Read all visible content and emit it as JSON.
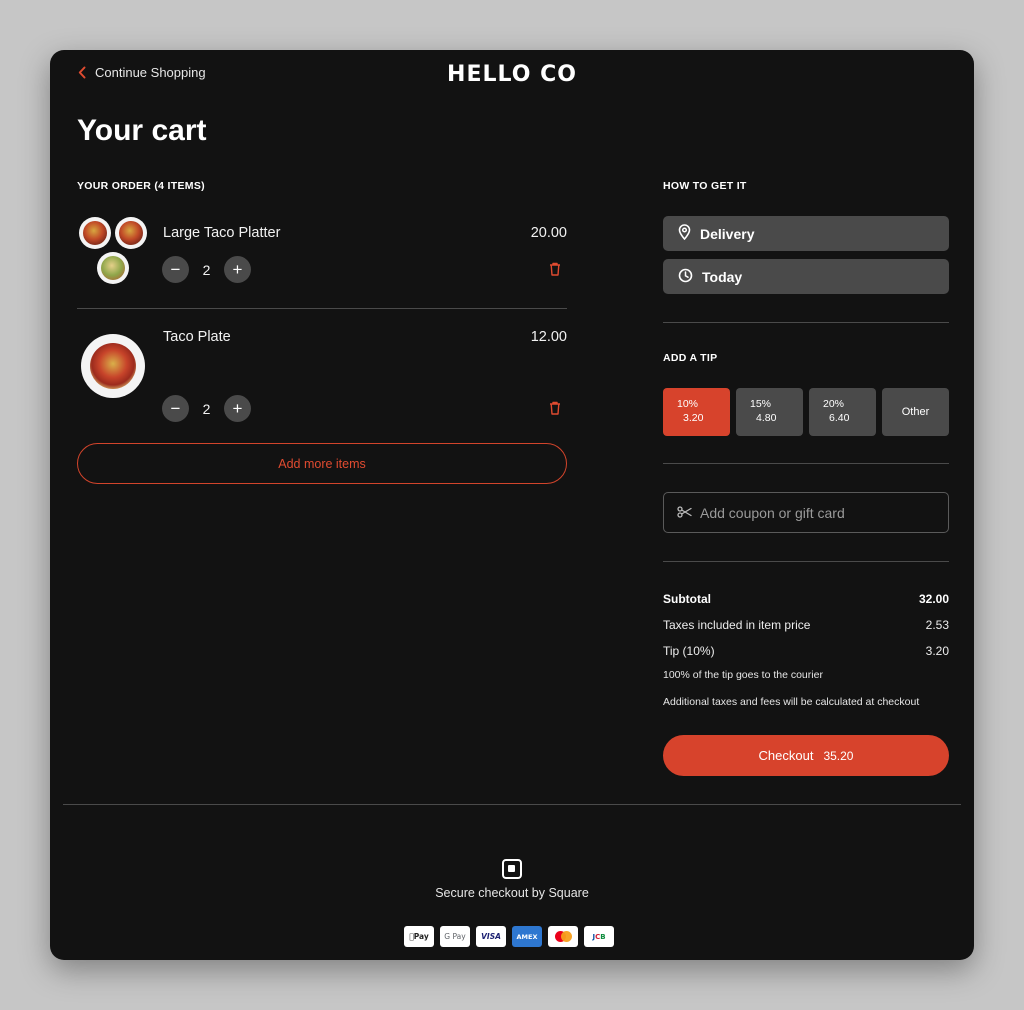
{
  "header": {
    "back_label": "Continue Shopping",
    "logo": "HELLO CO",
    "title": "Your cart"
  },
  "order": {
    "heading": "YOUR ORDER (4 ITEMS)",
    "items": [
      {
        "name": "Large Taco Platter",
        "price": "20.00",
        "qty": "2"
      },
      {
        "name": "Taco Plate",
        "price": "12.00",
        "qty": "2"
      }
    ],
    "add_more_label": "Add more items"
  },
  "fulfillment": {
    "heading": "HOW TO GET IT",
    "method": "Delivery",
    "time": "Today"
  },
  "tip": {
    "heading": "ADD A TIP",
    "options": [
      {
        "pct": "10%",
        "amount": "3.20",
        "selected": true
      },
      {
        "pct": "15%",
        "amount": "4.80",
        "selected": false
      },
      {
        "pct": "20%",
        "amount": "6.40",
        "selected": false
      }
    ],
    "other_label": "Other"
  },
  "coupon": {
    "placeholder": "Add coupon or gift card"
  },
  "summary": {
    "subtotal_label": "Subtotal",
    "subtotal": "32.00",
    "taxes_label": "Taxes included in item price",
    "taxes": "2.53",
    "tip_label": "Tip (10%)",
    "tip": "3.20",
    "tip_note": "100% of the tip goes to the courier",
    "fees_note": "Additional taxes and fees will be calculated at checkout"
  },
  "checkout": {
    "label": "Checkout",
    "total": "35.20"
  },
  "footer": {
    "secure_text": "Secure checkout by Square",
    "payment_methods": [
      "Apple Pay",
      "Google Pay",
      "VISA",
      "AMEX",
      "Mastercard",
      "JCB"
    ]
  },
  "colors": {
    "accent": "#d7432c",
    "background": "#121212",
    "surface": "#4a4a4a",
    "page_bg": "#c6c6c6"
  },
  "icons": {
    "back": "chevron-left-icon",
    "delivery": "location-pin-icon",
    "time": "clock-icon",
    "remove": "trash-icon",
    "coupon": "scissors-icon",
    "square": "square-logo-icon"
  }
}
